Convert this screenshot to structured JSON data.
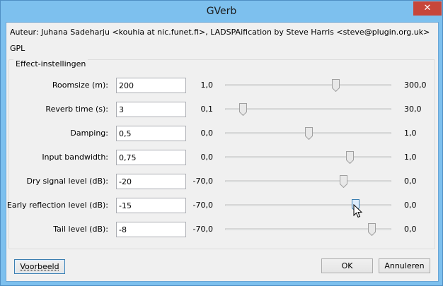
{
  "window": {
    "title": "GVerb",
    "close_symbol": "✕"
  },
  "info": {
    "author": "Auteur: Juhana Sadeharju <kouhia at nic.funet.fi>, LADSPAification by Steve Harris <steve@plugin.org.uk>",
    "license": "GPL"
  },
  "group": {
    "label": "Effect-instellingen"
  },
  "params": [
    {
      "label": "Roomsize (m):",
      "value": "200",
      "min": "1,0",
      "max": "300,0",
      "level": 0.664
    },
    {
      "label": "Reverb time (s):",
      "value": "3",
      "min": "0,1",
      "max": "30,0",
      "level": 0.097
    },
    {
      "label": "Damping:",
      "value": "0,5",
      "min": "0,0",
      "max": "1,0",
      "level": 0.5
    },
    {
      "label": "Input bandwidth:",
      "value": "0,75",
      "min": "0,0",
      "max": "1,0",
      "level": 0.75
    },
    {
      "label": "Dry signal level (dB):",
      "value": "-20",
      "min": "-70,0",
      "max": "0,0",
      "level": 0.714
    },
    {
      "label": "Early reflection level (dB):",
      "value": "-15",
      "min": "-70,0",
      "max": "0,0",
      "level": 0.786
    },
    {
      "label": "Tail level (dB):",
      "value": "-8",
      "min": "-70,0",
      "max": "0,0",
      "level": 0.886
    }
  ],
  "buttons": {
    "preview": "Voorbeeld",
    "ok": "OK",
    "cancel": "Annuleren"
  },
  "colors": {
    "title_bar": "#7dc0ee",
    "close_button": "#c7463a"
  }
}
